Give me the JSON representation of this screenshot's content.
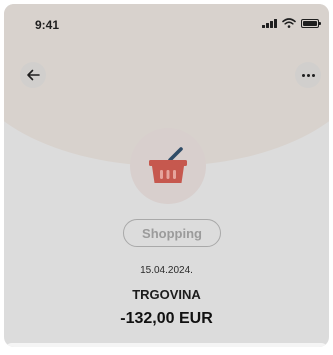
{
  "status_bar": {
    "time": "9:41",
    "icons": [
      "signal-icon",
      "wifi-icon",
      "battery-icon"
    ]
  },
  "header": {
    "back_icon": "arrow-left-icon",
    "more_icon": "more-horizontal-icon"
  },
  "transaction": {
    "category_icon": "shopping-basket-icon",
    "category_label": "Shopping",
    "date": "15.04.2024.",
    "merchant": "TRGOVINA",
    "amount": "-132,00 EUR"
  },
  "colors": {
    "background": "#dcdcdc",
    "hero_background": "#d8d2cd",
    "basket_red": "#c6584e",
    "basket_handle": "#2f4c67",
    "tag_text": "#9b9b9b"
  }
}
